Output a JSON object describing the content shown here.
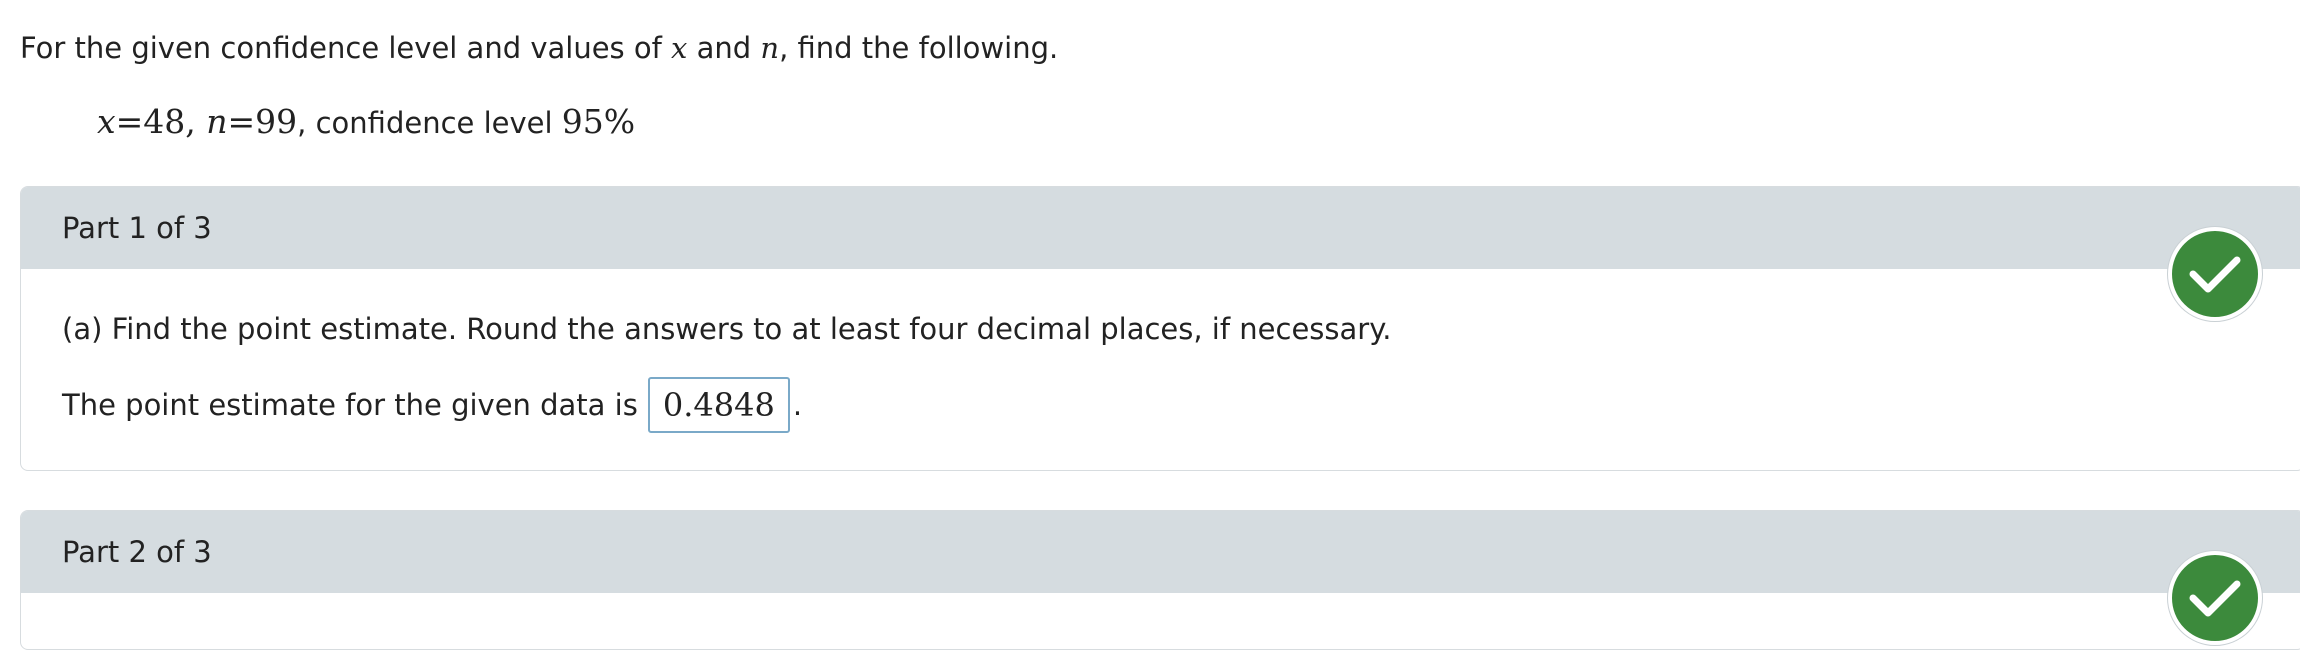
{
  "problem": {
    "intro_before": "For the given confidence level and values of ",
    "intro_var_x": "x",
    "intro_and": " and ",
    "intro_var_n": "n",
    "intro_after": ", find the following.",
    "given_x_var": "x",
    "given_x_eq": "=48, ",
    "given_n_var": "n",
    "given_n_eq": "=99",
    "given_conf_label": ", confidence level ",
    "given_conf_value": "95%"
  },
  "parts": [
    {
      "title": "Part 1 of 3",
      "status": "correct",
      "question": "(a) Find the point estimate. Round the answers to at least four decimal places, if necessary.",
      "answer_prefix": "The point estimate for the given data is",
      "answer_value": "0.4848",
      "answer_suffix": "."
    },
    {
      "title": "Part 2 of 3",
      "status": "correct"
    }
  ],
  "colors": {
    "header_bg": "#d5dce0",
    "check_green": "#3c8a3c",
    "answer_border": "#7aa9c8"
  },
  "icons": {
    "status_correct": "checkmark-circle-icon"
  }
}
